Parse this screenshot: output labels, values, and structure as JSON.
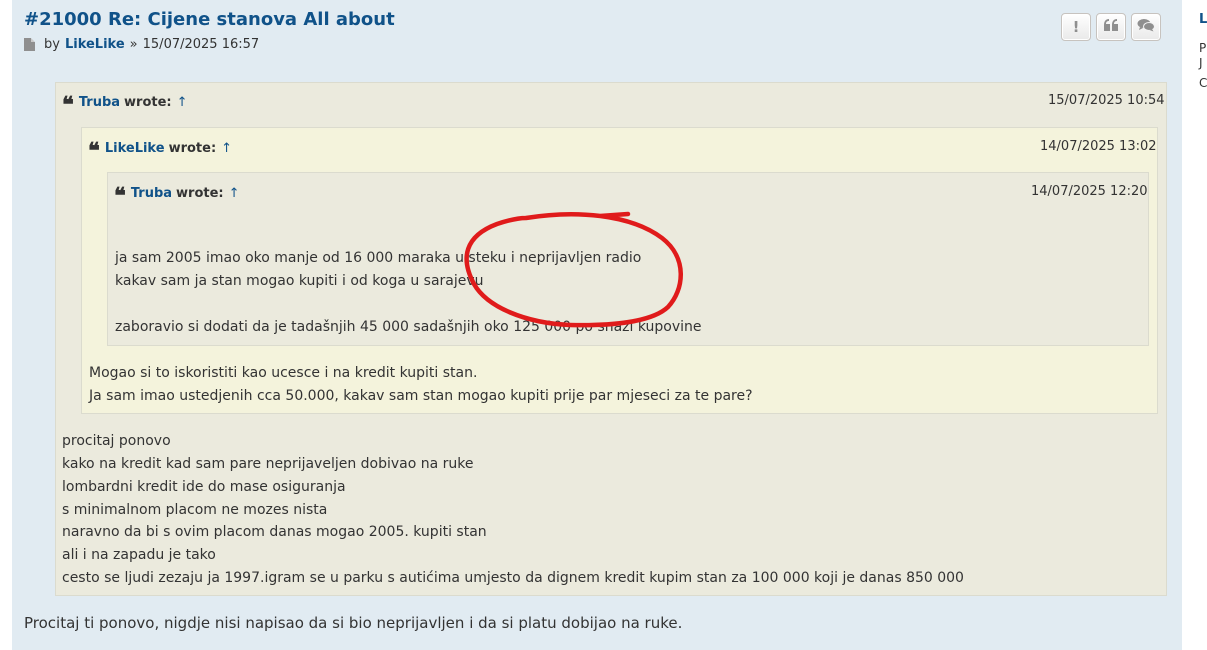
{
  "post": {
    "title": "#21000 Re: Cijene stanova All about",
    "by": "by",
    "author": "LikeLike",
    "sep": "»",
    "datetime": "15/07/2025 16:57",
    "reply": "Procitaj ti ponovo, nigdje nisi napisao da si bio neprijavljen i da si platu dobijao na ruke."
  },
  "buttons": {
    "report": "!",
    "quote": "❝",
    "reply": "💬"
  },
  "sidebar": {
    "name": "L",
    "line1": "P",
    "line2": "J",
    "line3": "C"
  },
  "quote1": {
    "author": "Truba",
    "wrote": "wrote:",
    "arrow": "↑",
    "date": "15/07/2025 10:54",
    "lines": [
      "procitaj ponovo",
      "kako na kredit kad sam pare neprijaveljen dobivao na ruke",
      "lombardni kredit ide do mase osiguranja",
      "s minimalnom placom ne mozes nista",
      "naravno da bi s ovim placom danas mogao 2005. kupiti stan",
      "ali i na zapadu je tako",
      "cesto se ljudi zezaju ja 1997.igram se u parku s autićima umjesto da dignem kredit kupim stan za 100 000 koji je danas 850 000"
    ]
  },
  "quote2": {
    "author": "LikeLike",
    "wrote": "wrote:",
    "arrow": "↑",
    "date": "14/07/2025 13:02",
    "lines": [
      "Mogao si to iskoristiti kao ucesce i na kredit kupiti stan.",
      "Ja sam imao ustedjenih cca 50.000, kakav sam stan mogao kupiti prije par mjeseci za te pare?"
    ]
  },
  "quote3": {
    "author": "Truba",
    "wrote": "wrote:",
    "arrow": "↑",
    "date": "14/07/2025 12:20",
    "lines": [
      "ja sam 2005 imao oko manje od 16 000 maraka u steku i neprijavljen radio",
      "kakav sam ja stan mogao kupiti i od koga u sarajevu",
      "zaboravio si dodati da je tadašnjih 45 000 sadašnjih oko 125 000 po snazi kupovine"
    ]
  },
  "colors": {
    "link": "#105289",
    "post_bg": "#e1ebf2",
    "quote_bg": "#ebeadd",
    "quote_alt_bg": "#f4f3dc",
    "annotation": "#e01b1b"
  }
}
